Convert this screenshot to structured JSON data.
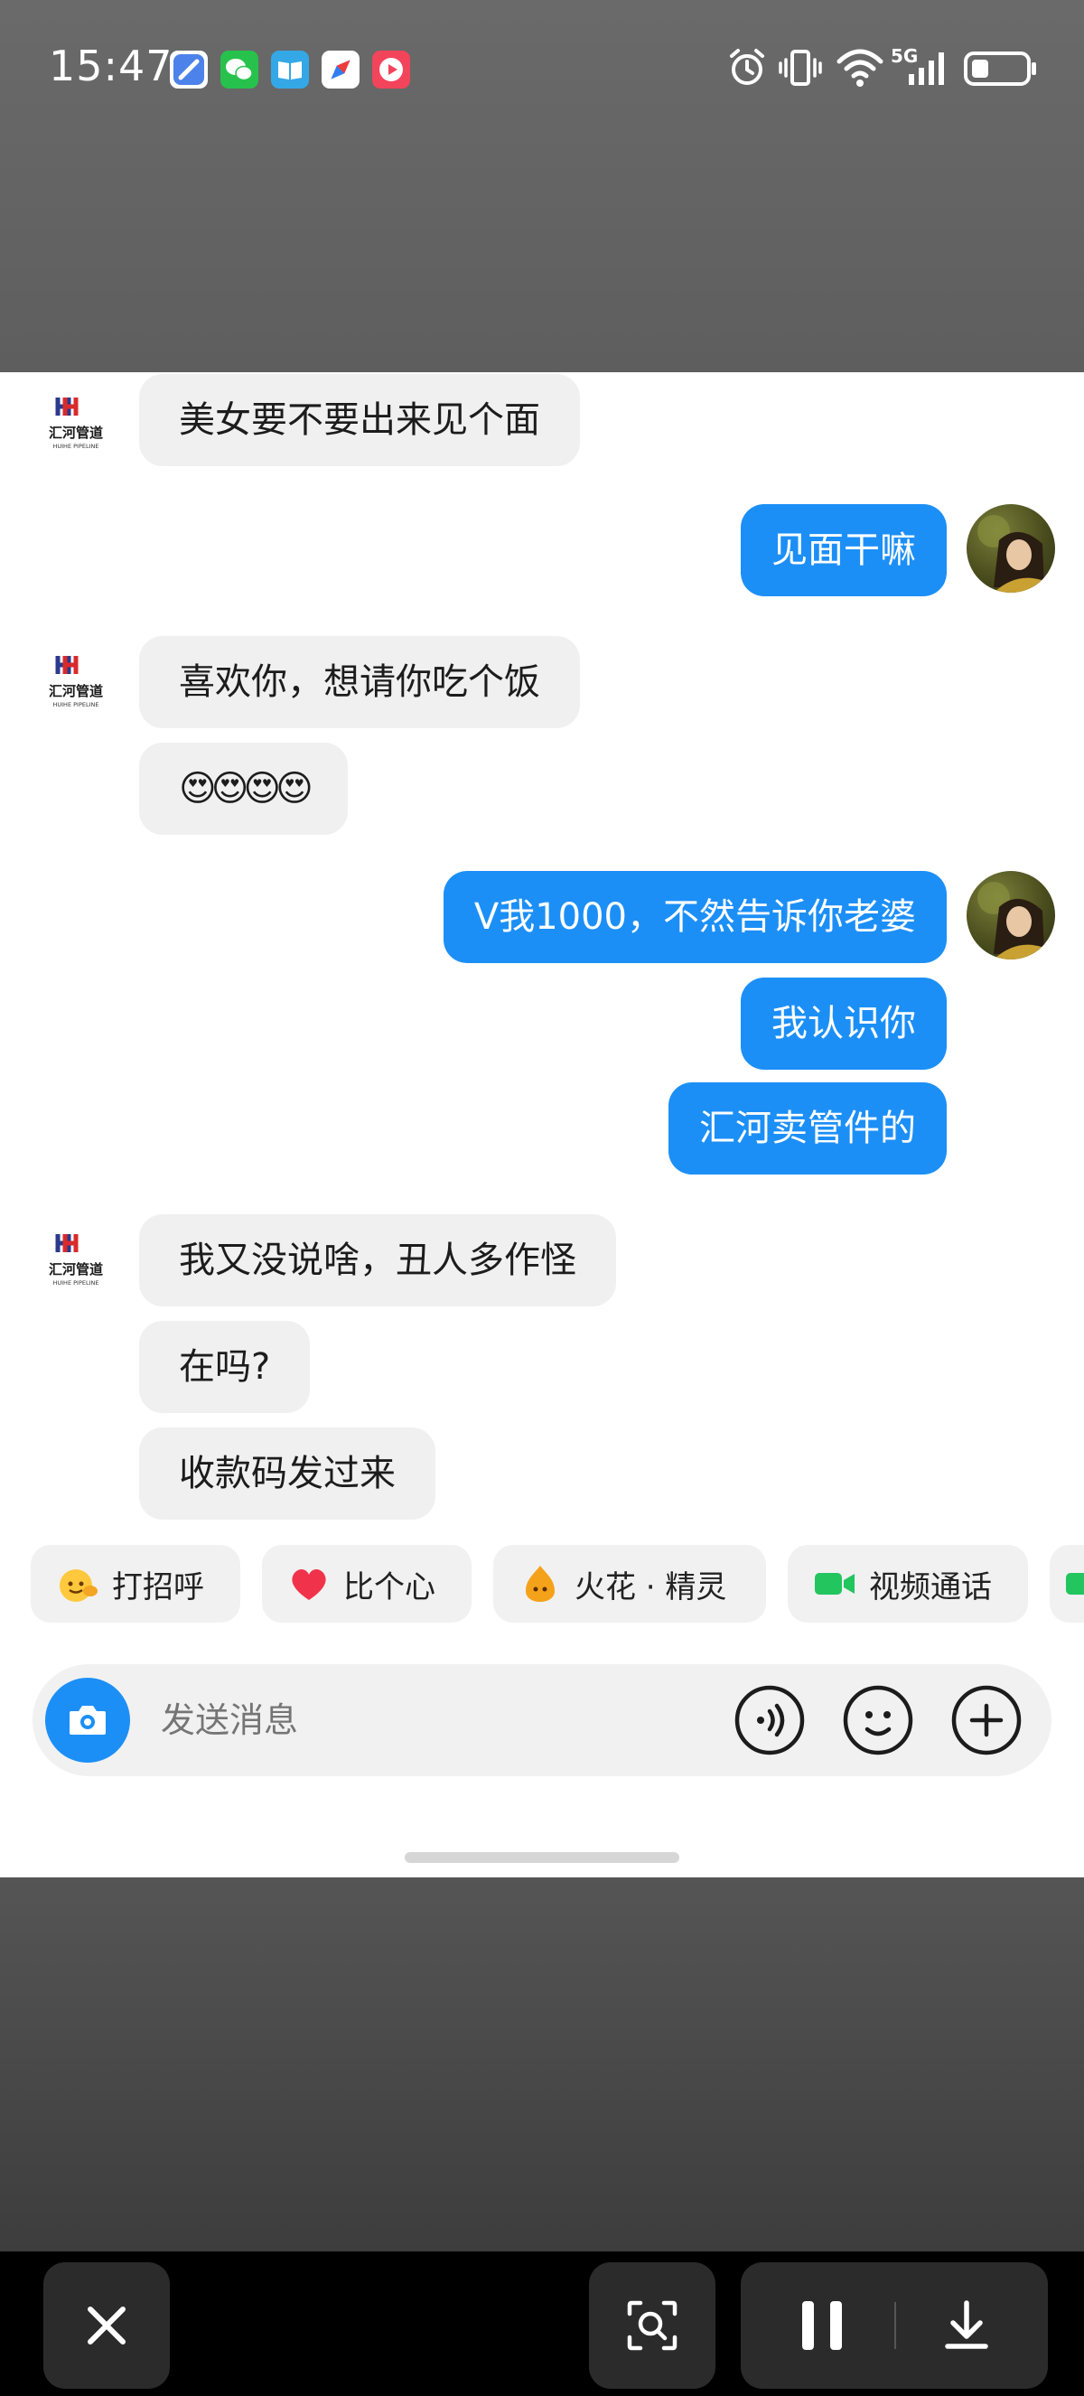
{
  "status_bar": {
    "time": "15:47",
    "network": "5G",
    "icons": [
      "browser-icon",
      "wechat-icon",
      "book-icon",
      "compass-icon",
      "video-app-icon",
      "alarm-icon",
      "vibrate-icon",
      "wifi-icon",
      "signal-icon",
      "battery-icon"
    ]
  },
  "chat": {
    "contact_logo_text": "汇河管道",
    "contact_logo_subtext": "HUIHE PIPELINE",
    "messages": [
      {
        "side": "left",
        "text": "美女要不要出来见个面"
      },
      {
        "side": "right",
        "text": "见面干嘛"
      },
      {
        "side": "left",
        "text": "喜欢你，想请你吃个饭"
      },
      {
        "side": "left",
        "text": "😍😍😍😍"
      },
      {
        "side": "right",
        "text": "V我1000，不然告诉你老婆"
      },
      {
        "side": "right",
        "text": "我认识你"
      },
      {
        "side": "right",
        "text": "汇河卖管件的"
      },
      {
        "side": "left",
        "text": "我又没说啥，丑人多作怪"
      },
      {
        "side": "left",
        "text": "在吗?"
      },
      {
        "side": "left",
        "text": "收款码发过来"
      }
    ]
  },
  "quick_actions": [
    {
      "label": "打招呼",
      "icon": "wave-emoji-icon"
    },
    {
      "label": "比个心",
      "icon": "heart-icon"
    },
    {
      "label": "火花 · 精灵",
      "icon": "spark-sprite-icon"
    },
    {
      "label": "视频通话",
      "icon": "video-call-icon"
    }
  ],
  "composer": {
    "placeholder": "发送消息",
    "buttons": [
      "camera-icon",
      "voice-icon",
      "emoji-icon",
      "plus-icon"
    ]
  },
  "recorder_toolbar": {
    "buttons": [
      "close-icon",
      "screenshot-search-icon",
      "pause-icon",
      "download-icon"
    ]
  },
  "colors": {
    "accent_blue": "#1c8ff7",
    "bubble_gray": "#f0f0f0",
    "video_green": "#22c55e",
    "heart_red": "#f0334a"
  }
}
